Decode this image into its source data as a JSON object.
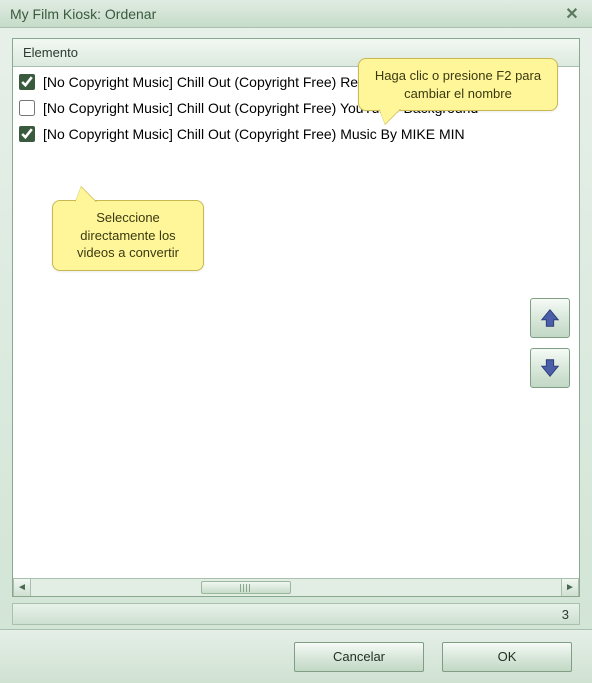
{
  "window": {
    "title": "My Film Kiosk: Ordenar"
  },
  "list": {
    "column_header": "Elemento",
    "items": [
      {
        "checked": true,
        "label": "[No Copyright Music] Chill Out (Copyright Free) Relaxing Music By M"
      },
      {
        "checked": false,
        "label": "[No Copyright Music] Chill Out (Copyright Free) YouTuber Background"
      },
      {
        "checked": true,
        "label": "[No Copyright Music] Chill Out (Copyright Free) Music By MIKE MIN"
      }
    ]
  },
  "status": {
    "count": "3"
  },
  "buttons": {
    "cancel": "Cancelar",
    "ok": "OK"
  },
  "callouts": {
    "rename": "Haga clic o presione F2 para cambiar el nombre",
    "select": "Seleccione directamente los videos a convertir"
  }
}
